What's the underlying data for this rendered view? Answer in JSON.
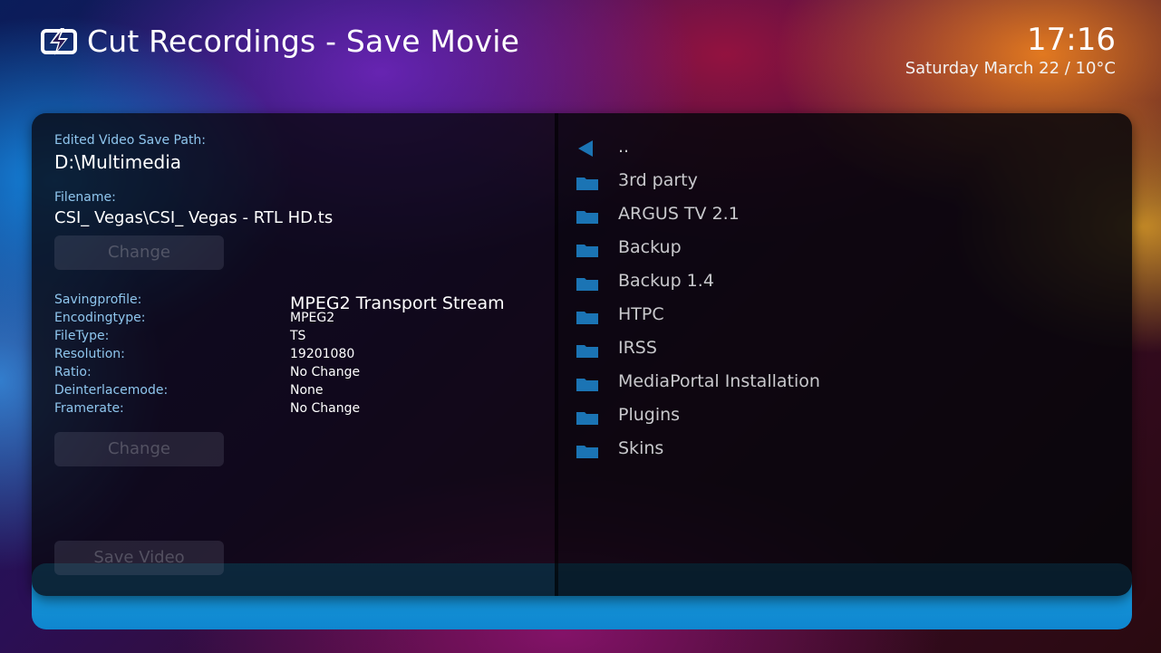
{
  "header": {
    "title": "Cut Recordings - Save Movie",
    "time": "17:16",
    "date": "Saturday March 22 / 10°C"
  },
  "left": {
    "save_path_label": "Edited Video Save Path:",
    "save_path_value": "D:\\Multimedia",
    "filename_label": "Filename:",
    "filename_value": "CSI_ Vegas\\CSI_ Vegas - RTL HD.ts",
    "change_button_1": "Change",
    "change_button_2": "Change",
    "save_button": "Save Video",
    "properties": [
      {
        "label": "Savingprofile:",
        "value": "MPEG2 Transport Stream"
      },
      {
        "label": "Encodingtype:",
        "value": "MPEG2"
      },
      {
        "label": "FileType:",
        "value": "TS"
      },
      {
        "label": "Resolution:",
        "value": "19201080"
      },
      {
        "label": "Ratio:",
        "value": "No Change"
      },
      {
        "label": "Deinterlacemode:",
        "value": "None"
      },
      {
        "label": "Framerate:",
        "value": "No Change"
      }
    ]
  },
  "browser": {
    "back_label": "..",
    "items": [
      {
        "label": "3rd party",
        "icon": "folder-icon"
      },
      {
        "label": "ARGUS TV 2.1",
        "icon": "folder-icon"
      },
      {
        "label": "Backup",
        "icon": "folder-icon"
      },
      {
        "label": "Backup 1.4",
        "icon": "folder-icon"
      },
      {
        "label": "HTPC",
        "icon": "folder-icon"
      },
      {
        "label": "IRSS",
        "icon": "folder-icon"
      },
      {
        "label": "MediaPortal Installation",
        "icon": "folder-icon"
      },
      {
        "label": "Plugins",
        "icon": "folder-icon"
      },
      {
        "label": "Skins",
        "icon": "folder-icon"
      }
    ]
  },
  "colors": {
    "accent": "#1a9fe0",
    "label_blue": "#8fc6ee",
    "folder_blue": "#1b74b4"
  }
}
